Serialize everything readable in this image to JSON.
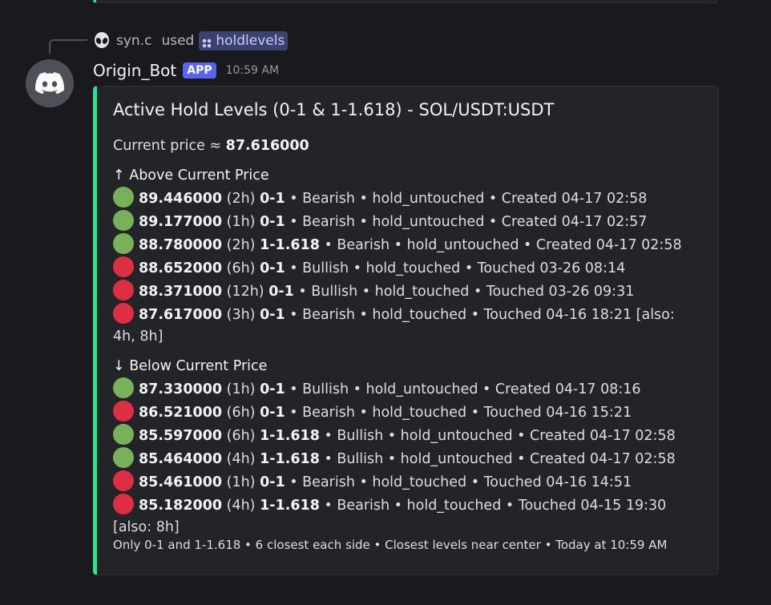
{
  "context": {
    "user": "syn.c",
    "used": "used",
    "command": "holdlevels"
  },
  "message": {
    "username": "Origin_Bot",
    "badge": "APP",
    "timestamp": "10:59 AM"
  },
  "embed": {
    "accent_color": "#23e68f",
    "title": "Active Hold Levels (0-1 & 1-1.618) - SOL/USDT:USDT",
    "current_price_label": "Current price ≈ ",
    "current_price_value": "87.616000",
    "sections": [
      {
        "heading": "↑ Above Current Price",
        "rows": [
          {
            "status": "green",
            "price": "89.446000",
            "tf": " (2h) ",
            "range": "0-1",
            "rest": " • Bearish • hold_untouched • Created 04-17 02:58"
          },
          {
            "status": "green",
            "price": "89.177000",
            "tf": " (1h) ",
            "range": "0-1",
            "rest": " • Bearish • hold_untouched • Created 04-17 02:57"
          },
          {
            "status": "green",
            "price": "88.780000",
            "tf": " (2h) ",
            "range": "1-1.618",
            "rest": " • Bearish • hold_untouched • Created 04-17 02:58"
          },
          {
            "status": "red",
            "price": "88.652000",
            "tf": " (6h) ",
            "range": "0-1",
            "rest": " • Bullish • hold_touched • Touched 03-26 08:14"
          },
          {
            "status": "red",
            "price": "88.371000",
            "tf": " (12h) ",
            "range": "0-1",
            "rest": " • Bullish • hold_touched • Touched 03-26 09:31"
          },
          {
            "status": "red",
            "price": "87.617000",
            "tf": " (3h) ",
            "range": "0-1",
            "rest": " • Bearish • hold_touched • Touched 04-16 18:21 [also: 4h, 8h]"
          }
        ]
      },
      {
        "heading": "↓ Below Current Price",
        "rows": [
          {
            "status": "green",
            "price": "87.330000",
            "tf": " (1h) ",
            "range": "0-1",
            "rest": " • Bullish • hold_untouched • Created 04-17 08:16"
          },
          {
            "status": "red",
            "price": "86.521000",
            "tf": " (6h) ",
            "range": "0-1",
            "rest": " • Bearish • hold_touched • Touched 04-16 15:21"
          },
          {
            "status": "green",
            "price": "85.597000",
            "tf": " (6h) ",
            "range": "1-1.618",
            "rest": " • Bullish • hold_untouched • Created 04-17 02:58"
          },
          {
            "status": "green",
            "price": "85.464000",
            "tf": " (4h) ",
            "range": "1-1.618",
            "rest": " • Bullish • hold_untouched • Created 04-17 02:58"
          },
          {
            "status": "red",
            "price": "85.461000",
            "tf": " (1h) ",
            "range": "0-1",
            "rest": " • Bearish • hold_touched • Touched 04-16 14:51"
          },
          {
            "status": "red",
            "price": "85.182000",
            "tf": " (4h) ",
            "range": "1-1.618",
            "rest": " • Bearish • hold_touched • Touched 04-15 19:30 [also: 8h]"
          }
        ]
      }
    ],
    "footer": "Only 0-1 and 1-1.618 • 6 closest each side • Closest levels near center • Today at 10:59 AM"
  },
  "colors": {
    "green_dot": "#78b159",
    "red_dot": "#dd2e44",
    "app_badge": "#5865f2"
  }
}
